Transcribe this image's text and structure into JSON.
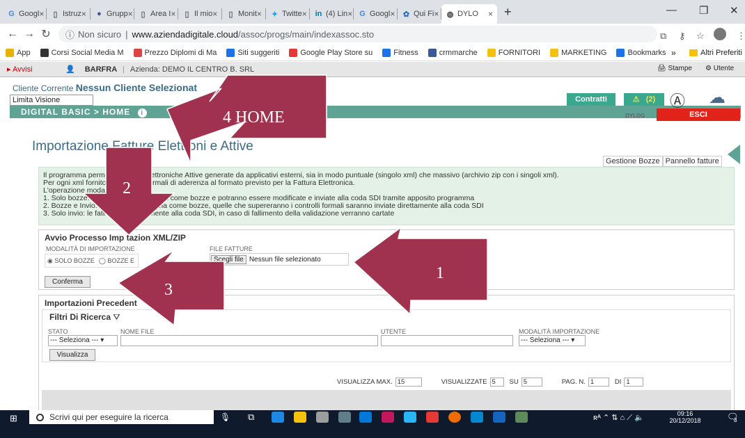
{
  "browser": {
    "tabs": [
      {
        "label": "Googl",
        "icon": "G",
        "color": "#4285f4"
      },
      {
        "label": "Istruz",
        "icon": "▯",
        "color": "#666"
      },
      {
        "label": "Grupp",
        "icon": "●",
        "color": "#3b5998"
      },
      {
        "label": "Area I",
        "icon": "▯",
        "color": "#666"
      },
      {
        "label": "Il mio",
        "icon": "▯",
        "color": "#666"
      },
      {
        "label": "Monit",
        "icon": "▯",
        "color": "#666"
      },
      {
        "label": "Twitte",
        "icon": "✦",
        "color": "#1da1f2"
      },
      {
        "label": "(4) Lin",
        "icon": "in",
        "color": "#0077b5"
      },
      {
        "label": "Googl",
        "icon": "G",
        "color": "#4285f4"
      },
      {
        "label": "Qui Fi",
        "icon": "✿",
        "color": "#2a6ebb"
      },
      {
        "label": "DYLO",
        "icon": "◍",
        "color": "#444"
      }
    ],
    "url_prefix": "Non sicuro",
    "url_host": "www.aziendadigitale.cloud",
    "url_path": "/assoc/progs/main/indexassoc.sto",
    "bookmarks": [
      {
        "label": "App",
        "color": "#e8b100"
      },
      {
        "label": "Corsi Social Media M",
        "color": "#333"
      },
      {
        "label": "Prezzo Diplomi di Ma",
        "color": "#d44"
      },
      {
        "label": "Siti suggeriti",
        "color": "#1a73e8"
      },
      {
        "label": "Google Play Store su",
        "color": "#e53935"
      },
      {
        "label": "Fitness",
        "color": "#1a73e8"
      },
      {
        "label": "crmmarche",
        "color": "#3b5998"
      },
      {
        "label": "FORNITORI",
        "color": "#f4c20d"
      },
      {
        "label": "MARKETING",
        "color": "#f4c20d"
      },
      {
        "label": "Bookmarks",
        "color": "#1a73e8"
      }
    ],
    "bookmarks_more": "»",
    "bookmarks_other": "Altri Preferiti"
  },
  "app": {
    "avvisi": "Avvisi",
    "user": "BARFRA",
    "azienda": "Azienda: DEMO IL CENTRO B. SRL",
    "stampe": "Stampe",
    "utente": "Utente",
    "cliente_prefix": "Cliente Corrente",
    "cliente_value": "Nessun Cliente Selezionat",
    "limita": "Limita Visione Scrivania",
    "breadcrumb": "DIGITAL BASIC  >  HOME",
    "contratti": "Contratti",
    "alert_count": "(2)",
    "esci": "ESCI",
    "dylog_logo": "DYLOG"
  },
  "page": {
    "title": "Importazione Fatture Elettroni      e Attive",
    "gestione_bozze": "Gestione Bozze",
    "pannello_fatture": "Pannello fatture",
    "info_lines": [
      "Il programma perme                                         to Fatture Elettroniche Attive generate da applicativi esterni, sia in modo puntuale (singolo xml) che massivo (archivio zip con i singoli xml).",
      "Per ogni xml fornito                            iti i controlli formali di aderenza al formato previsto per la Fattura Elettronica.",
      "L'operazione                                                    modalità:",
      "1. Solo bozze:                          nno inserite nel sistema come bozze e potranno essere modificate e inviate alla coda SDI tramite apposito programma",
      "2. Bozze e Invio:                      mportate nel sistema come bozze, quelle che supereranno i controlli formali saranno inviate direttamente alla coda SDI",
      "3. Solo invio: le fatt                  nviate direttamente alla coda SDI, in caso di fallimento della validazione verranno      cartate"
    ],
    "avvio_title": "Avvio Processo Imp      tazion   XML/ZIP",
    "modalita_label": "MODALITÀ DI IMPORTAZIONE",
    "radio_solo_bozze": "SOLO BOZZE",
    "radio_bozze": "BOZZE E",
    "file_label": "FILE FATTURE",
    "scegli_file": "Scegli file",
    "nessun_file": "Nessun file selezionato",
    "conferma": "Conferma",
    "importazioni_title": "Importazioni Precedent",
    "filtri_title": "Filtri Di Ricerca",
    "stato_label": "STATO",
    "stato_value": "--- Seleziona --- ▾",
    "nome_file_label": "NOME FILE",
    "utente_label": "UTENTE",
    "modalita_imp_label": "MODALITÀ IMPORTAZIONE",
    "modalita_imp_value": "--- Seleziona --- ▾",
    "visualizza": "Visualizza",
    "visualizza_max_label": "VISUALIZZA MAX.",
    "visualizza_max_value": "15",
    "visualizzate_label": "VISUALIZZATE",
    "visualizzate_value": "5",
    "su_label": "SU",
    "su_value": "5",
    "pag_label": "PAG. N.",
    "pag_value": "1",
    "di_label": "DI",
    "di_value": "1"
  },
  "annotations": {
    "label_1": "1",
    "label_2": "2",
    "label_3": "3",
    "label_4": "4 HOME",
    "arrow_color": "#a0324f"
  },
  "taskbar": {
    "search_placeholder": "Scrivi qui per eseguire la ricerca",
    "time": "09:16",
    "date": "20/12/2018",
    "notif_count": "3"
  }
}
